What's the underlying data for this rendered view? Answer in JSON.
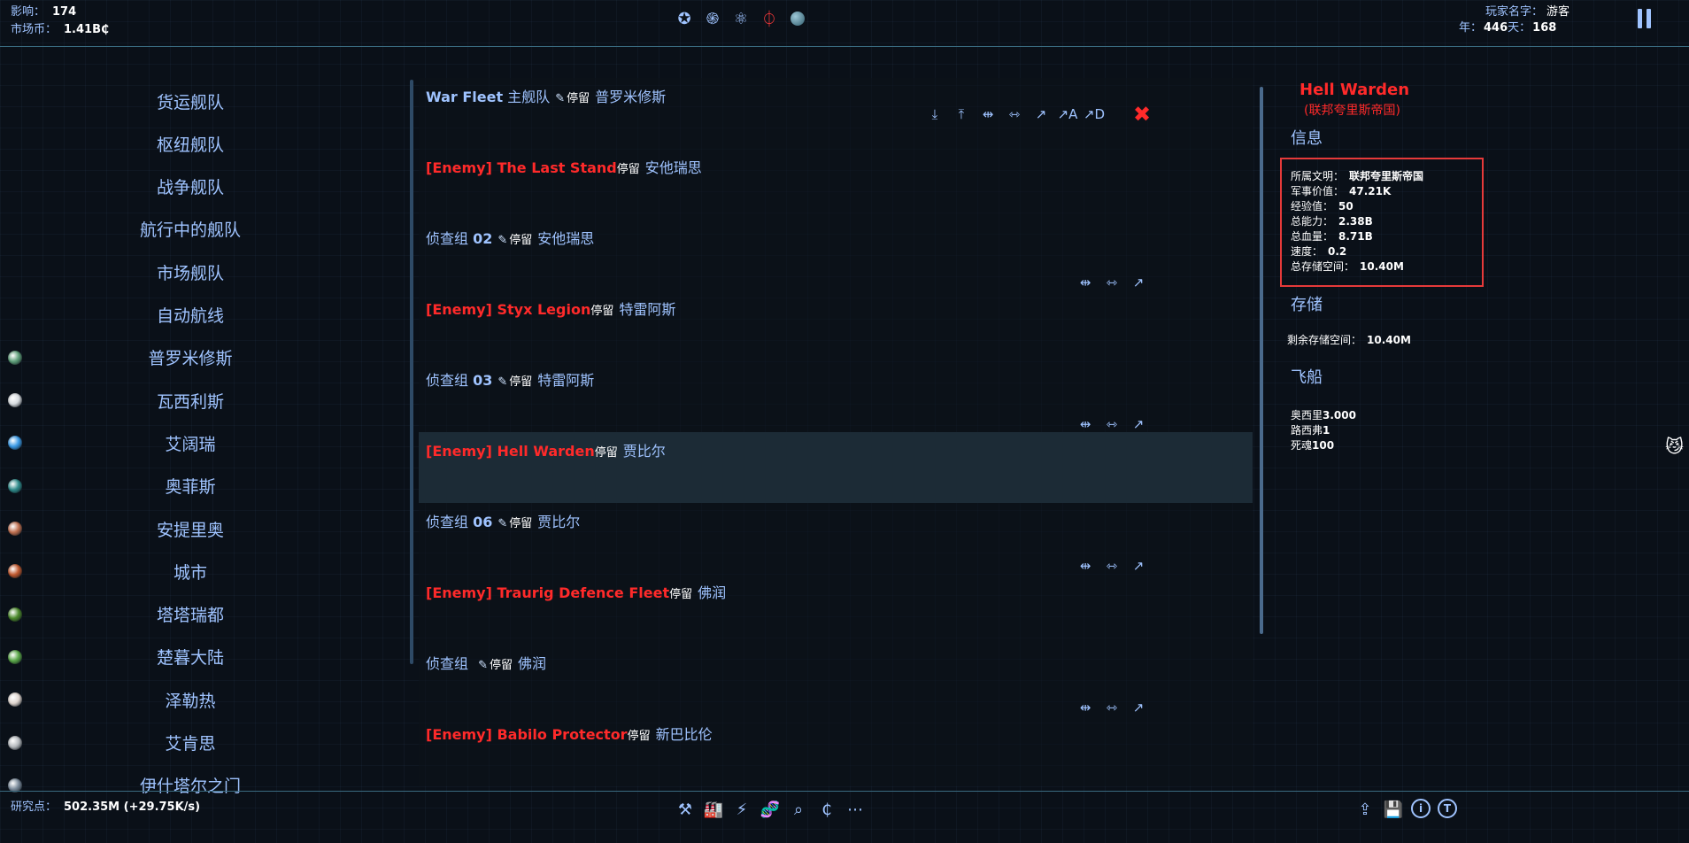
{
  "topbar": {
    "influence_label": "影响：",
    "influence_value": "174",
    "market_label": "市场币：",
    "market_value": "1.41B₵",
    "player_label": "玩家名字：",
    "player_value": "游客",
    "year_label": "年：",
    "year_value": "446",
    "day_label": "天：",
    "day_value": "168",
    "nav_icons": [
      "star-map-icon",
      "galaxy-icon",
      "atom-icon",
      "faction-icon",
      "planet-icon"
    ]
  },
  "left_list": {
    "items": [
      {
        "label": "货运舰队"
      },
      {
        "label": "枢纽舰队"
      },
      {
        "label": "战争舰队"
      },
      {
        "label": "航行中的舰队"
      },
      {
        "label": "市场舰队"
      },
      {
        "label": "自动航线"
      },
      {
        "label": "普罗米修斯",
        "color": "#5fa07a"
      },
      {
        "label": "瓦西利斯",
        "color": "#d8dce0"
      },
      {
        "label": "艾阔瑞",
        "color": "#3a9ae6"
      },
      {
        "label": "奥菲斯",
        "color": "#2f8c8c"
      },
      {
        "label": "安提里奥",
        "color": "#c07050"
      },
      {
        "label": "城市",
        "color": "#c0582e"
      },
      {
        "label": "塔塔瑞都",
        "color": "#4c8a2c"
      },
      {
        "label": "楚暮大陆",
        "color": "#5aa848"
      },
      {
        "label": "泽勒热",
        "color": "#e0d6d0"
      },
      {
        "label": "艾肯思",
        "color": "#b8bcc0"
      },
      {
        "label": "伊什塔尔之门",
        "color": "#7a8a9a"
      }
    ]
  },
  "fleets": [
    {
      "kind": "own",
      "name": "War Fleet",
      "suffix": "主舰队",
      "status": "停留",
      "location": "普罗米修斯"
    },
    {
      "kind": "enemy",
      "name": "[Enemy] The Last Stand",
      "status": "停留",
      "location": "安他瑞思"
    },
    {
      "kind": "own",
      "name_prefix": "侦查组",
      "name_num": "02",
      "status": "停留",
      "location": "安他瑞思"
    },
    {
      "kind": "enemy",
      "name": "[Enemy] Styx Legion",
      "status": "停留",
      "location": "特雷阿斯"
    },
    {
      "kind": "own",
      "name_prefix": "侦查组",
      "name_num": "03",
      "status": "停留",
      "location": "特雷阿斯"
    },
    {
      "kind": "enemy",
      "name": "[Enemy] Hell Warden",
      "status": "停留",
      "location": "贾比尔",
      "selected": true
    },
    {
      "kind": "own",
      "name_prefix": "侦查组",
      "name_num": "06",
      "status": "停留",
      "location": "贾比尔"
    },
    {
      "kind": "enemy",
      "name": "[Enemy] Traurig Defence Fleet",
      "status": "停留",
      "location": "佛润"
    },
    {
      "kind": "own",
      "name_prefix": "侦查组",
      "name_num": "",
      "status": "停留",
      "location": "佛润"
    },
    {
      "kind": "enemy",
      "name": "[Enemy] Babilo Protector",
      "status": "停留",
      "location": "新巴比伦"
    }
  ],
  "detail": {
    "title": "Hell Warden",
    "subtitle": "(联邦夸里斯帝国)",
    "info_heading": "信息",
    "info": [
      {
        "label": "所属文明：",
        "value": "联邦夸里斯帝国"
      },
      {
        "label": "军事价值：",
        "value": "47.21K"
      },
      {
        "label": "经验值：",
        "value": "50"
      },
      {
        "label": "总能力：",
        "value": "2.38B"
      },
      {
        "label": "总血量：",
        "value": "8.71B"
      },
      {
        "label": "速度：",
        "value": "0.2"
      },
      {
        "label": "总存储空间：",
        "value": "10.40M"
      }
    ],
    "storage_heading": "存储",
    "storage_label": "剩余存储空间：",
    "storage_value": "10.40M",
    "ships_heading": "飞船",
    "ships": [
      {
        "name": "奥西里",
        "count": "3.000"
      },
      {
        "name": "路西弗",
        "count": "1"
      },
      {
        "name": "死魂",
        "count": "100"
      }
    ]
  },
  "bottombar": {
    "research_label": "研究点：",
    "research_value": "502.35M (+29.75K/s)"
  }
}
